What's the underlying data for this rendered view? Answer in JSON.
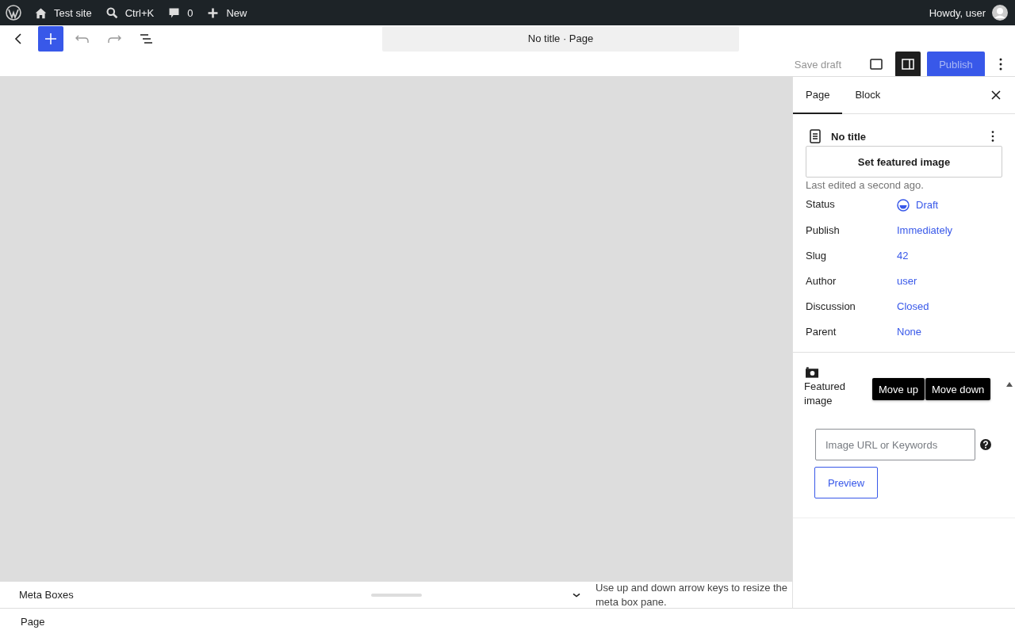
{
  "admin_bar": {
    "site": "Test site",
    "search_shortcut": "Ctrl+K",
    "comments": "0",
    "new": "New",
    "greeting": "Howdy, user"
  },
  "toolbar": {
    "document_title": "No title · Page",
    "save_draft": "Save draft",
    "publish": "Publish",
    "settings_open": true
  },
  "sidebar": {
    "tabs": [
      {
        "label": "Page",
        "selected": true
      },
      {
        "label": "Block",
        "selected": false
      }
    ],
    "title": "No title",
    "featured_button": "Set featured image",
    "last_edited": "Last edited a second ago.",
    "fields": [
      {
        "label": "Status",
        "value": "Draft",
        "kind": "status"
      },
      {
        "label": "Publish",
        "value": "Immediately",
        "kind": "link"
      },
      {
        "label": "Slug",
        "value": "42",
        "kind": "link"
      },
      {
        "label": "Author",
        "value": "user",
        "kind": "link"
      },
      {
        "label": "Discussion",
        "value": "Closed",
        "kind": "link"
      },
      {
        "label": "Parent",
        "value": "None",
        "kind": "link"
      }
    ],
    "featured_panel": {
      "title": "Featured image",
      "move_up": "Move up",
      "move_down": "Move down",
      "placeholder": "Image URL or Keywords",
      "preview": "Preview"
    }
  },
  "meta_boxes": {
    "title": "Meta Boxes",
    "hint": "Use up and down arrow keys to resize the meta box pane."
  },
  "footer": {
    "breadcrumb": "Page"
  }
}
